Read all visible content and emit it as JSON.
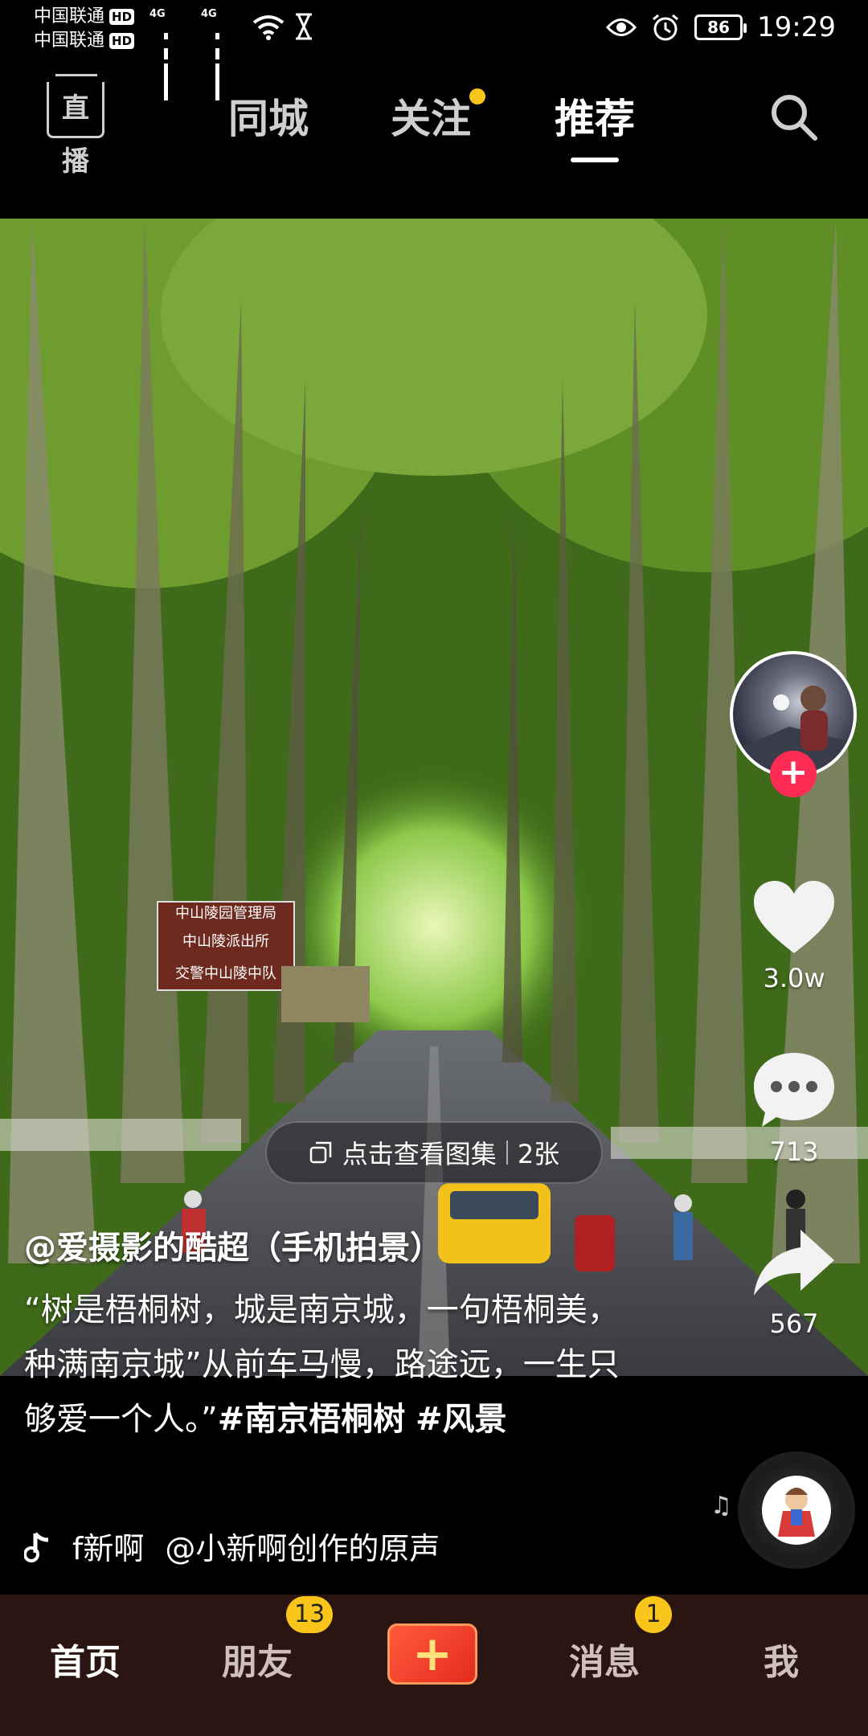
{
  "status_bar": {
    "carrier1": "中国联通",
    "carrier2": "中国联通",
    "hd": "HD",
    "net1": "4G",
    "net2": "4G",
    "battery": "86",
    "time": "19:29"
  },
  "top_nav": {
    "live": "直播",
    "tabs": [
      {
        "label": "同城"
      },
      {
        "label": "关注"
      },
      {
        "label": "推荐"
      }
    ],
    "active_tab": "推荐"
  },
  "post": {
    "gallery_label": "点击查看图集",
    "gallery_count": "2张",
    "author": "@爱摄影的酷超（手机拍景）",
    "desc_text": "“树是梧桐树，城是南京城，一句梧桐美，种满南京城”从前车马慢，路途远，一生只够爱一个人。”",
    "hashtag1": "#南京梧桐树",
    "hashtag2": "#风景",
    "music_prefix": "f新啊",
    "music_title": "@小新啊创作的原声",
    "sign_lines": [
      "中山陵园管理局",
      "中山陵派出所",
      "交警中山陵中队"
    ]
  },
  "rail": {
    "likes": "3.0w",
    "comments": "713",
    "shares": "567"
  },
  "bottom_nav": {
    "home": "首页",
    "friends": "朋友",
    "friends_badge": "13",
    "messages": "消息",
    "messages_badge": "1",
    "me": "我",
    "plus": "+"
  },
  "colors": {
    "accent_red": "#fe2c55",
    "badge_yellow": "#f9c51a",
    "bottom_bg": "#2a1512"
  }
}
